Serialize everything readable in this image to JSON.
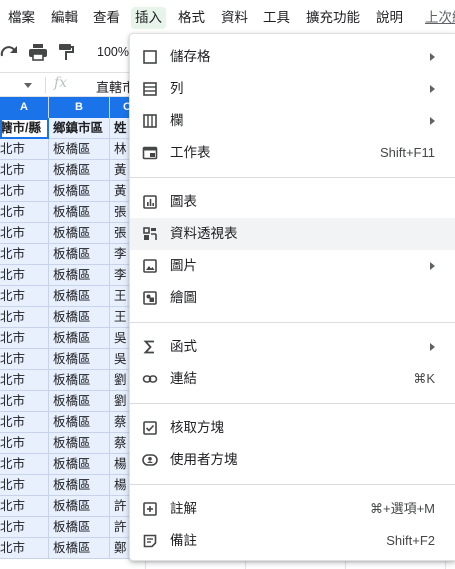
{
  "menubar": {
    "items": [
      {
        "label": "檔案"
      },
      {
        "label": "編輯"
      },
      {
        "label": "查看"
      },
      {
        "label": "插入"
      },
      {
        "label": "格式"
      },
      {
        "label": "資料"
      },
      {
        "label": "工具"
      },
      {
        "label": "擴充功能"
      },
      {
        "label": "說明"
      },
      {
        "label": "上次編"
      }
    ],
    "active_index": 3
  },
  "toolbar": {
    "zoom": "100%"
  },
  "formula_bar": {
    "value": "直轄市"
  },
  "sheet": {
    "columns": [
      "A",
      "B",
      "C"
    ],
    "header_row": [
      "轄市/縣",
      "鄉鎮市區",
      "姓"
    ],
    "rows": [
      [
        "北市",
        "板橋區",
        "林"
      ],
      [
        "北市",
        "板橋區",
        "黃"
      ],
      [
        "北市",
        "板橋區",
        "黃"
      ],
      [
        "北市",
        "板橋區",
        "張"
      ],
      [
        "北市",
        "板橋區",
        "張"
      ],
      [
        "北市",
        "板橋區",
        "李"
      ],
      [
        "北市",
        "板橋區",
        "李"
      ],
      [
        "北市",
        "板橋區",
        "王"
      ],
      [
        "北市",
        "板橋區",
        "王"
      ],
      [
        "北市",
        "板橋區",
        "吳"
      ],
      [
        "北市",
        "板橋區",
        "吳"
      ],
      [
        "北市",
        "板橋區",
        "劉"
      ],
      [
        "北市",
        "板橋區",
        "劉"
      ],
      [
        "北市",
        "板橋區",
        "蔡"
      ],
      [
        "北市",
        "板橋區",
        "蔡"
      ],
      [
        "北市",
        "板橋區",
        "楊"
      ],
      [
        "北市",
        "板橋區",
        "楊"
      ],
      [
        "北市",
        "板橋區",
        "許"
      ],
      [
        "北市",
        "板橋區",
        "許"
      ],
      [
        "北市",
        "板橋區",
        "鄭"
      ]
    ]
  },
  "insert_menu": {
    "groups": [
      [
        {
          "icon": "cell-icon",
          "label": "儲存格",
          "shortcut": "",
          "submenu": true
        },
        {
          "icon": "row-icon",
          "label": "列",
          "shortcut": "",
          "submenu": true
        },
        {
          "icon": "column-icon",
          "label": "欄",
          "shortcut": "",
          "submenu": true
        },
        {
          "icon": "sheet-icon",
          "label": "工作表",
          "shortcut": "Shift+F11",
          "submenu": false
        }
      ],
      [
        {
          "icon": "chart-icon",
          "label": "圖表",
          "shortcut": "",
          "submenu": false
        },
        {
          "icon": "pivot-table-icon",
          "label": "資料透視表",
          "shortcut": "",
          "submenu": false,
          "highlighted": true
        },
        {
          "icon": "image-icon",
          "label": "圖片",
          "shortcut": "",
          "submenu": true
        },
        {
          "icon": "drawing-icon",
          "label": "繪圖",
          "shortcut": "",
          "submenu": false
        }
      ],
      [
        {
          "icon": "sigma-icon",
          "label": "函式",
          "shortcut": "",
          "submenu": true
        },
        {
          "icon": "link-icon",
          "label": "連結",
          "shortcut": "⌘K",
          "submenu": false
        }
      ],
      [
        {
          "icon": "checkbox-icon",
          "label": "核取方塊",
          "shortcut": "",
          "submenu": false
        },
        {
          "icon": "people-chip-icon",
          "label": "使用者方塊",
          "shortcut": "",
          "submenu": false
        }
      ],
      [
        {
          "icon": "comment-icon",
          "label": "註解",
          "shortcut": "⌘+選項+M",
          "submenu": false
        },
        {
          "icon": "note-icon",
          "label": "備註",
          "shortcut": "Shift+F2",
          "submenu": false
        }
      ]
    ]
  }
}
